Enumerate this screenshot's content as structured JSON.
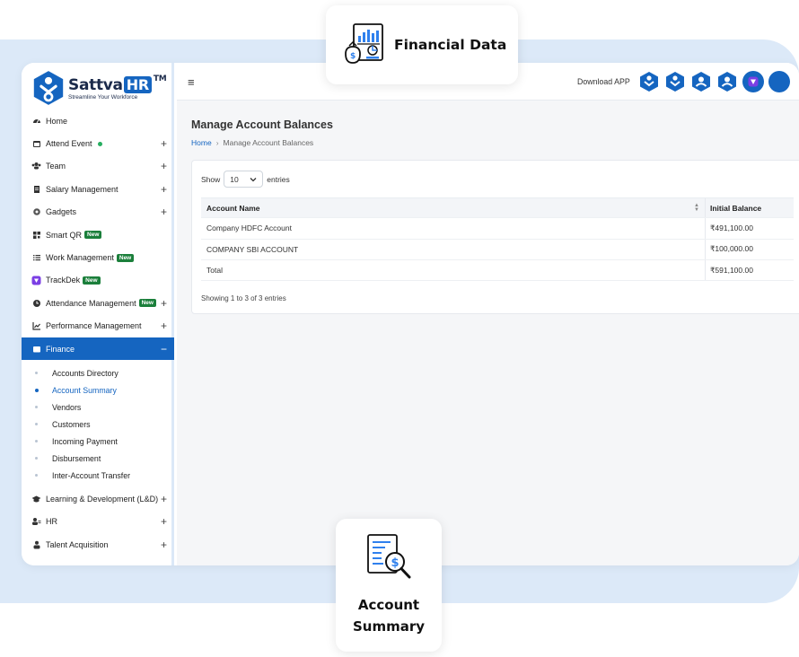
{
  "brand": {
    "name": "Sattva",
    "name_hr": "HR",
    "trademark": "TM",
    "tagline": "Streamline Your Workforce"
  },
  "callouts": {
    "top_label": "Financial Data",
    "bottom_label_line1": "Account",
    "bottom_label_line2": "Summary"
  },
  "colors": {
    "accent": "#1565c0",
    "badge_new": "#1b7f3b",
    "backdrop": "#dce9f8"
  },
  "sidebar": {
    "items": [
      {
        "label": "Home",
        "icon": "dashboard-icon"
      },
      {
        "label": "Attend Event",
        "icon": "calendar-icon",
        "expand": "+"
      },
      {
        "label": "Team",
        "icon": "team-icon",
        "expand": "+"
      },
      {
        "label": "Salary Management",
        "icon": "document-icon",
        "expand": "+"
      },
      {
        "label": "Gadgets",
        "icon": "gadget-icon",
        "expand": "+"
      },
      {
        "label": "Smart QR",
        "icon": "qr-icon",
        "badge": "New"
      },
      {
        "label": "Work Management",
        "icon": "list-icon",
        "badge": "New"
      },
      {
        "label": "TrackDek",
        "icon": "trackdek-icon",
        "badge": "New"
      },
      {
        "label": "Attendance Management",
        "icon": "clock-icon",
        "badge": "New",
        "expand": "+"
      },
      {
        "label": "Performance Management",
        "icon": "chart-icon",
        "expand": "+"
      },
      {
        "label": "Finance",
        "icon": "wallet-icon",
        "expand": "−"
      },
      {
        "label": "Learning & Development (L&D)",
        "icon": "graduation-cap-icon",
        "expand": "+"
      },
      {
        "label": "HR",
        "icon": "hr-users-icon",
        "expand": "+"
      },
      {
        "label": "Talent Acquisition",
        "icon": "person-tie-icon",
        "expand": "+"
      }
    ],
    "finance_sub": [
      "Accounts Directory",
      "Account Summary",
      "Vendors",
      "Customers",
      "Incoming Payment",
      "Disbursement",
      "Inter-Account Transfer"
    ]
  },
  "header": {
    "menu_icon": "≡",
    "download_label": "Download APP"
  },
  "page": {
    "title": "Manage Account Balances",
    "breadcrumb_home": "Home",
    "breadcrumb_sep": "›",
    "breadcrumb_current": "Manage Account Balances"
  },
  "table": {
    "show_label": "Show",
    "entries_value": "10",
    "entries_label": "entries",
    "columns": [
      "Account Name",
      "Initial Balance"
    ],
    "rows": [
      [
        "Company HDFC Account",
        "₹491,100.00"
      ],
      [
        "COMPANY SBI ACCOUNT",
        "₹100,000.00"
      ],
      [
        "Total",
        "₹591,100.00"
      ]
    ],
    "info": "Showing 1 to 3 of 3 entries"
  }
}
